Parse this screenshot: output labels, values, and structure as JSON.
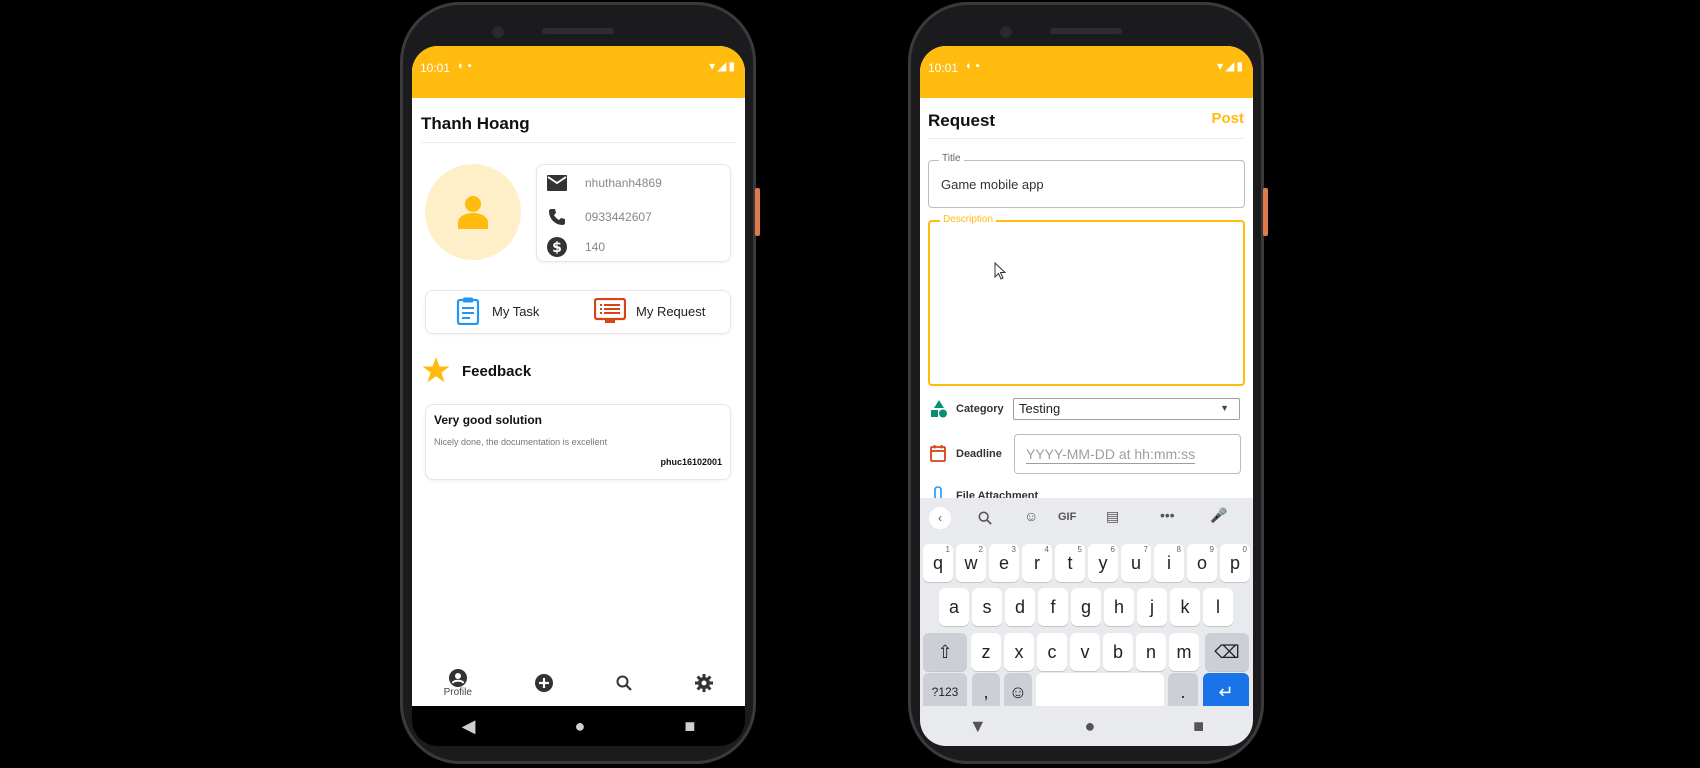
{
  "left": {
    "status_time": "10:01",
    "header_title": "Thanh Hoang",
    "email": "nhuthanh4869",
    "phone": "0933442607",
    "balance": "140",
    "my_task_label": "My Task",
    "my_request_label": "My Request",
    "feedback_title": "Feedback",
    "feedback": {
      "title": "Very good solution",
      "body": "Nicely done, the documentation is excellent",
      "author": "phuc16102001"
    },
    "nav_profile_label": "Profile"
  },
  "right": {
    "status_time": "10:01",
    "header_title": "Request",
    "post_label": "Post",
    "title_label": "Title",
    "title_value": "Game mobile app",
    "description_label": "Description",
    "description_value": "",
    "category_label": "Category",
    "category_value": "Testing",
    "deadline_label": "Deadline",
    "deadline_placeholder": "YYYY-MM-DD at hh:mm:ss",
    "file_label": "File Attachment",
    "keyboard": {
      "row1": [
        {
          "k": "q",
          "n": "1"
        },
        {
          "k": "w",
          "n": "2"
        },
        {
          "k": "e",
          "n": "3"
        },
        {
          "k": "r",
          "n": "4"
        },
        {
          "k": "t",
          "n": "5"
        },
        {
          "k": "y",
          "n": "6"
        },
        {
          "k": "u",
          "n": "7"
        },
        {
          "k": "i",
          "n": "8"
        },
        {
          "k": "o",
          "n": "9"
        },
        {
          "k": "p",
          "n": "0"
        }
      ],
      "row2": [
        "a",
        "s",
        "d",
        "f",
        "g",
        "h",
        "j",
        "k",
        "l"
      ],
      "row3": [
        "z",
        "x",
        "c",
        "v",
        "b",
        "n",
        "m"
      ],
      "symbols_label": "?123",
      "comma": ",",
      "period": ".",
      "gif_label": "GIF"
    }
  },
  "colors": {
    "accent": "#ffbb0e",
    "feedback_star": "#ffbb0e",
    "task_icon": "#2196f3",
    "request_icon": "#d84315"
  }
}
